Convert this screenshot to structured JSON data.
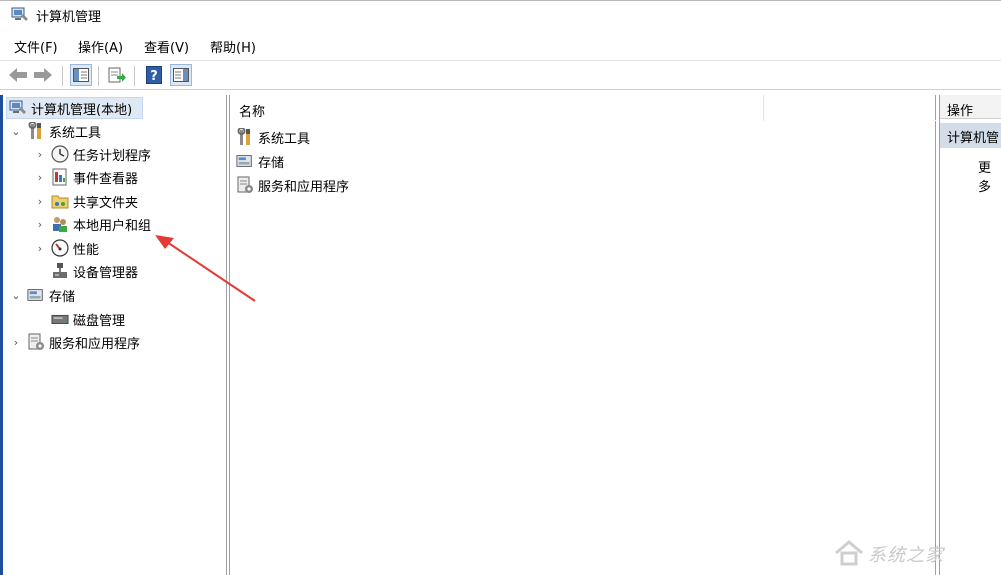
{
  "window": {
    "title": "计算机管理"
  },
  "menu": [
    "文件(F)",
    "操作(A)",
    "查看(V)",
    "帮助(H)"
  ],
  "toolbar": {
    "buttons": [
      "back-arrow-icon",
      "forward-arrow-icon",
      "show-hide-tree-icon",
      "export-list-icon",
      "help-icon",
      "show-hide-action-pane-icon"
    ]
  },
  "tree": {
    "root": "计算机管理(本地)",
    "system_tools": "系统工具",
    "task_scheduler": "任务计划程序",
    "event_viewer": "事件查看器",
    "shared_folders": "共享文件夹",
    "local_users_groups": "本地用户和组",
    "performance": "性能",
    "device_manager": "设备管理器",
    "storage": "存储",
    "disk_management": "磁盘管理",
    "services_apps": "服务和应用程序"
  },
  "list": {
    "column_name": "名称",
    "items": [
      "系统工具",
      "存储",
      "服务和应用程序"
    ]
  },
  "actions": {
    "header": "操作",
    "section": "计算机管",
    "more": "更多"
  },
  "watermark": {
    "text": "系统之家"
  },
  "colors": {
    "accent_arrow": "#e53935",
    "selection": "#dfe9f5",
    "action_section": "#d2dde9"
  }
}
